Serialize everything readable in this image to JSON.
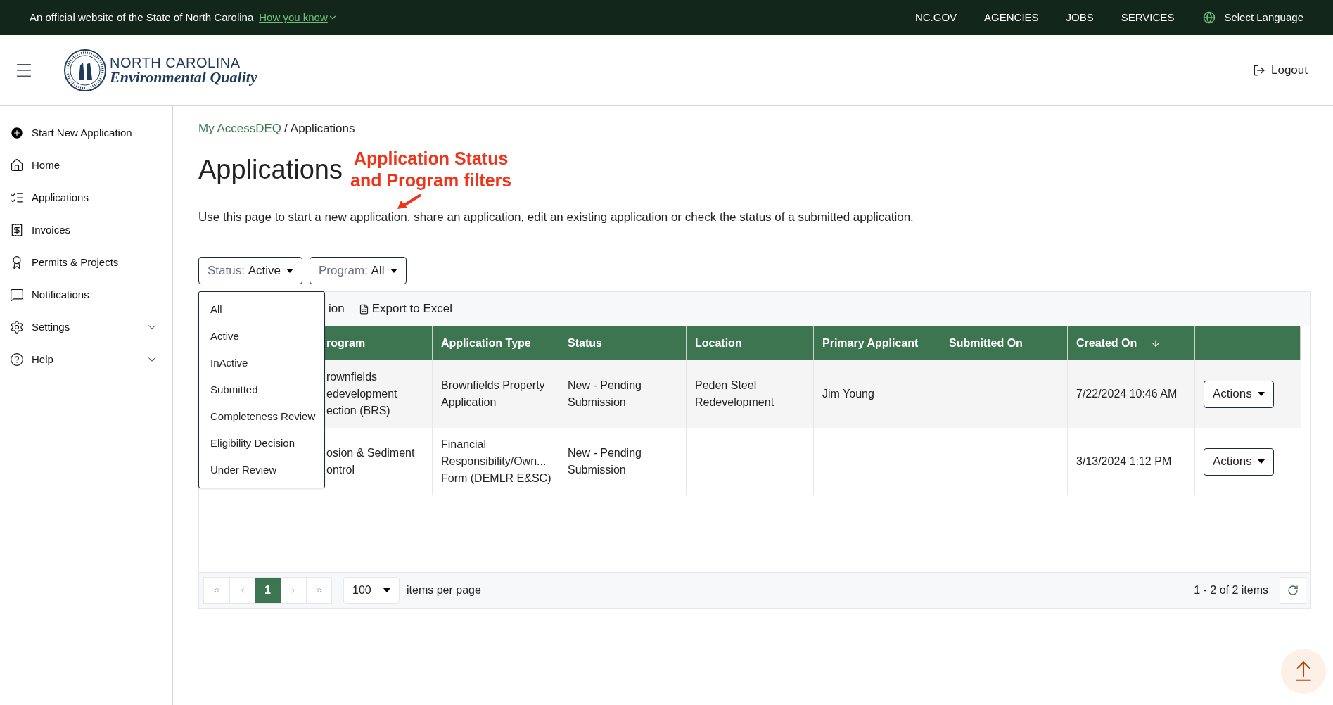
{
  "gov_banner": {
    "text": "An official website of the State of North Carolina",
    "link": "How you know",
    "nav": [
      "NC.GOV",
      "AGENCIES",
      "JOBS",
      "SERVICES"
    ],
    "language": "Select Language"
  },
  "header": {
    "logo_line1": "NORTH CAROLINA",
    "logo_line2": "Environmental Quality",
    "logout": "Logout"
  },
  "sidebar": {
    "items": [
      {
        "label": "Start New Application",
        "expandable": false
      },
      {
        "label": "Home",
        "expandable": false
      },
      {
        "label": "Applications",
        "expandable": false
      },
      {
        "label": "Invoices",
        "expandable": false
      },
      {
        "label": "Permits & Projects",
        "expandable": false
      },
      {
        "label": "Notifications",
        "expandable": false
      },
      {
        "label": "Settings",
        "expandable": true
      },
      {
        "label": "Help",
        "expandable": true
      }
    ]
  },
  "breadcrumb": {
    "link": "My AccessDEQ",
    "separator": "/",
    "current": "Applications"
  },
  "title": "Applications",
  "annotation": {
    "line1": "Application Status",
    "line2": "and Program filters"
  },
  "description": "Use this page to start a new application, share an application, edit an existing application or check the status of a submitted application.",
  "filters": [
    {
      "label": "Status:",
      "value": "Active"
    },
    {
      "label": "Program:",
      "value": "All"
    }
  ],
  "status_menu": [
    {
      "label": "All",
      "selected": false
    },
    {
      "label": "Active",
      "selected": false
    },
    {
      "label": "InActive",
      "selected": false
    },
    {
      "label": "Submitted",
      "selected": false
    },
    {
      "label": "Completeness Review",
      "selected": false
    },
    {
      "label": "Eligibility Decision",
      "selected": false
    },
    {
      "label": "Under Review",
      "selected": false
    }
  ],
  "toolbar": [
    {
      "label": "ion",
      "kind": "plain"
    },
    {
      "label": "Export to Excel",
      "kind": "export"
    }
  ],
  "table": {
    "columns": [
      {
        "label": "rogram",
        "sorted": false
      },
      {
        "label": "Application Type",
        "sorted": false
      },
      {
        "label": "Status",
        "sorted": false
      },
      {
        "label": "Location",
        "sorted": false
      },
      {
        "label": "Primary Applicant",
        "sorted": false
      },
      {
        "label": "Submitted On",
        "sorted": false
      },
      {
        "label": "Created On",
        "sorted": true
      },
      {
        "sorted": false
      }
    ],
    "rows": [
      {
        "cells": [
          "rownfields\nedevelopment\nection (BRS)",
          "Brownfields Property Application",
          "New - Pending Submission",
          "Peden Steel Redevelopment",
          "Jim Young",
          "",
          "7/22/2024 10:46 AM"
        ],
        "action": "Actions"
      },
      {
        "cells": [
          "osion & Sediment\nontrol",
          "Financial Responsibility/Own... Form (DEMLR E&SC)",
          "New - Pending Submission",
          "",
          "",
          "",
          "3/13/2024 1:12 PM"
        ],
        "action": "Actions"
      }
    ]
  },
  "pager": {
    "pages": [
      {
        "label": "1",
        "selected": true
      }
    ],
    "page_size": "100",
    "page_size_label": "items per page",
    "summary": "1 - 2 of 2 items"
  }
}
